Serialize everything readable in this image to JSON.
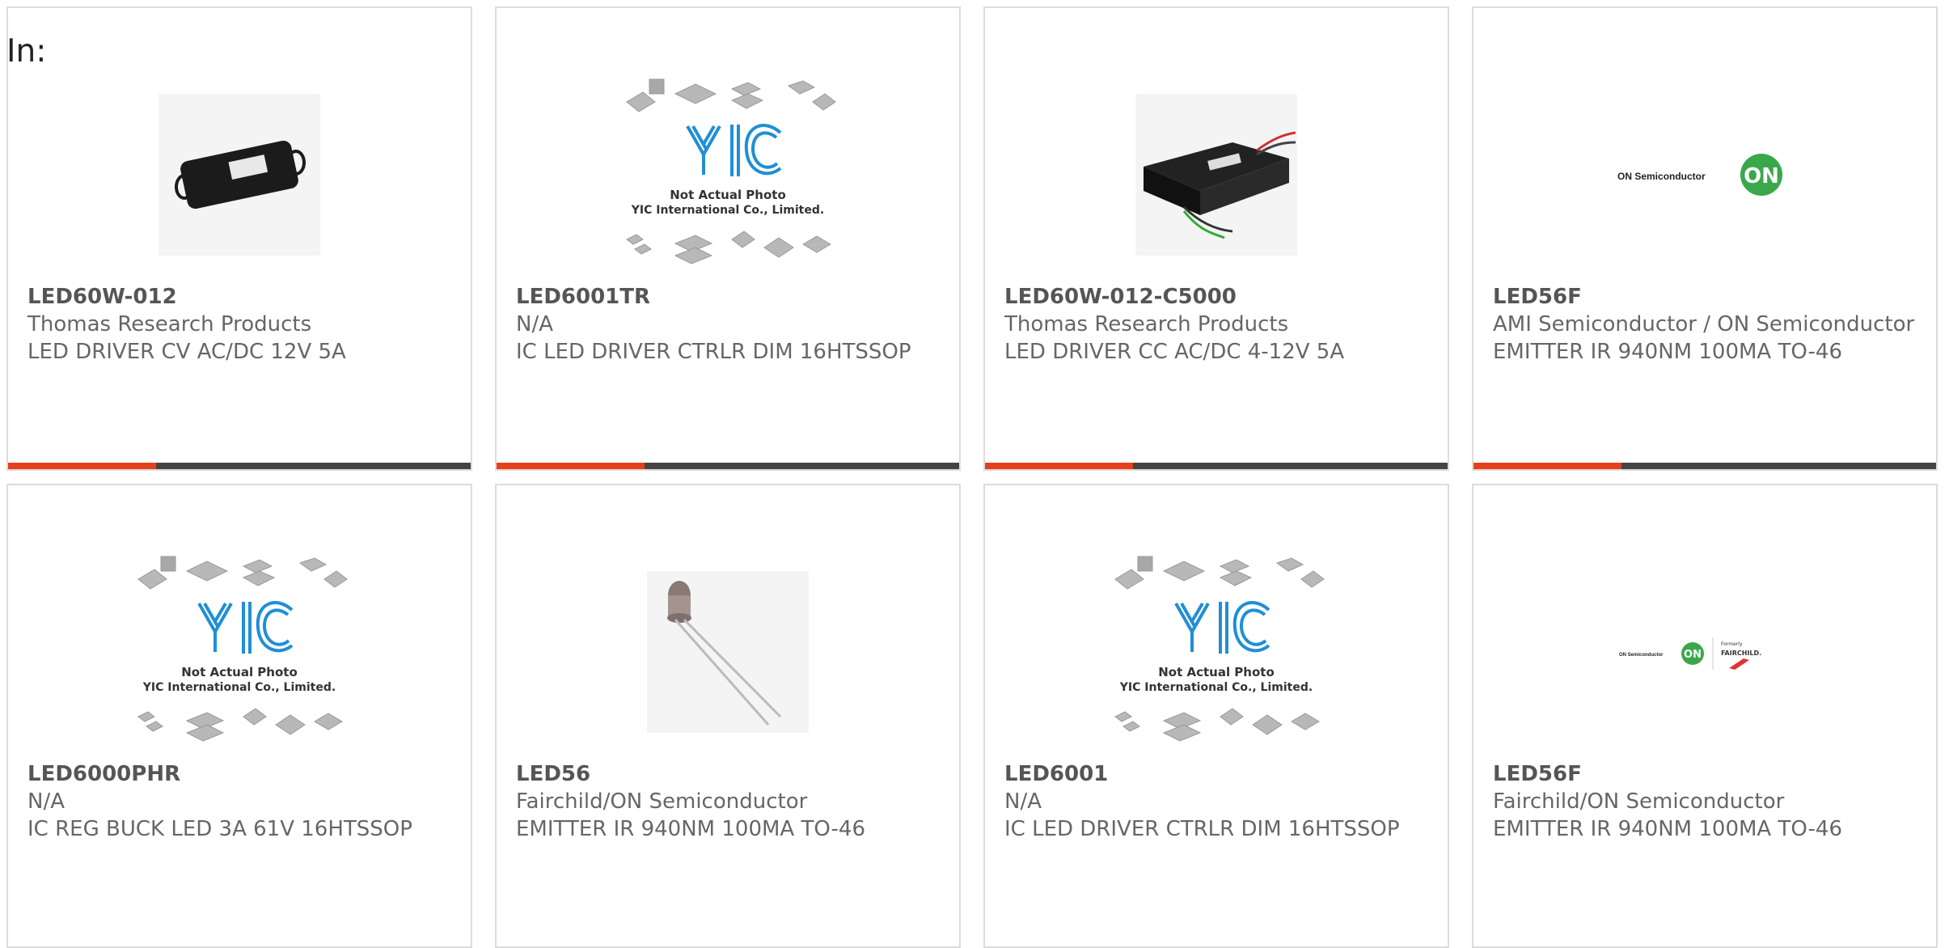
{
  "header": {
    "in_label": "In:"
  },
  "colors": {
    "accent": "#e5401a",
    "bar": "#444444",
    "yic_blue": "#1f8fd6",
    "on_green": "#3aa84a"
  },
  "cards": [
    {
      "part": "LED60W-012",
      "manufacturer": "Thomas Research Products",
      "description": "LED DRIVER CV AC/DC 12V 5A",
      "image": "led-driver-photo"
    },
    {
      "part": "LED6001TR",
      "manufacturer": "N/A",
      "description": "IC LED DRIVER CTRLR DIM 16HTSSOP",
      "image": "yic-placeholder",
      "placeholder_line1": "Not Actual Photo",
      "placeholder_line2": "YIC International Co., Limited."
    },
    {
      "part": "LED60W-012-C5000",
      "manufacturer": "Thomas Research Products",
      "description": "LED DRIVER CC AC/DC 4-12V 5A",
      "image": "led-driver-wired-photo"
    },
    {
      "part": "LED56F",
      "manufacturer": "AMI Semiconductor / ON Semiconductor",
      "description": "EMITTER IR 940NM 100MA TO-46",
      "image": "on-semi-logo",
      "logo_text": "ON Semiconductor",
      "logo_badge": "ON"
    },
    {
      "part": "LED6000PHR",
      "manufacturer": "N/A",
      "description": "IC REG BUCK LED 3A 61V 16HTSSOP",
      "image": "yic-placeholder",
      "placeholder_line1": "Not Actual Photo",
      "placeholder_line2": "YIC International Co., Limited."
    },
    {
      "part": "LED56",
      "manufacturer": "Fairchild/ON Semiconductor",
      "description": "EMITTER IR 940NM 100MA TO-46",
      "image": "ir-emitter-photo"
    },
    {
      "part": "LED6001",
      "manufacturer": "N/A",
      "description": "IC LED DRIVER CTRLR DIM 16HTSSOP",
      "image": "yic-placeholder",
      "placeholder_line1": "Not Actual Photo",
      "placeholder_line2": "YIC International Co., Limited."
    },
    {
      "part": "LED56F",
      "manufacturer": "Fairchild/ON Semiconductor",
      "description": "EMITTER IR 940NM 100MA TO-46",
      "image": "on-fairchild-logo",
      "logo_text": "ON Semiconductor",
      "logo_badge": "ON",
      "logo_formerly": "Formerly",
      "logo_fairchild": "FAIRCHILD."
    }
  ]
}
